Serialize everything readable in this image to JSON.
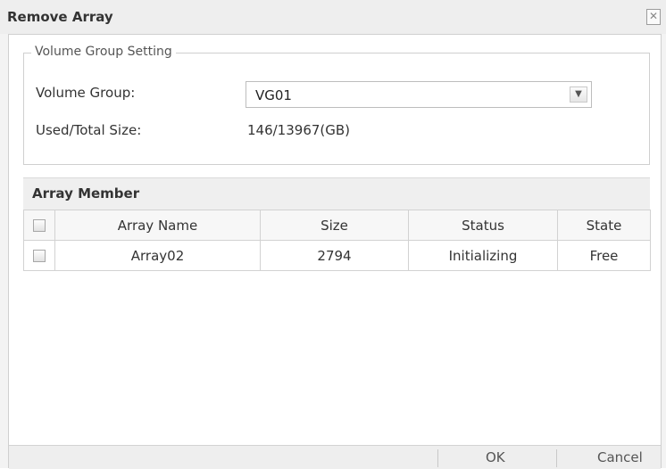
{
  "dialog": {
    "title": "Remove Array",
    "close_glyph": "✕"
  },
  "volume_group_setting": {
    "legend": "Volume Group Setting",
    "volume_group_label": "Volume Group:",
    "volume_group_value": "VG01",
    "used_total_label": "Used/Total Size:",
    "used_total_value": "146/13967(GB)"
  },
  "array_member": {
    "title": "Array Member",
    "columns": [
      "Array Name",
      "Size",
      "Status",
      "State"
    ],
    "rows": [
      {
        "name": "Array02",
        "size": "2794",
        "status": "Initializing",
        "state": "Free"
      }
    ]
  },
  "footer": {
    "ok_label": "OK",
    "cancel_label": "Cancel"
  }
}
